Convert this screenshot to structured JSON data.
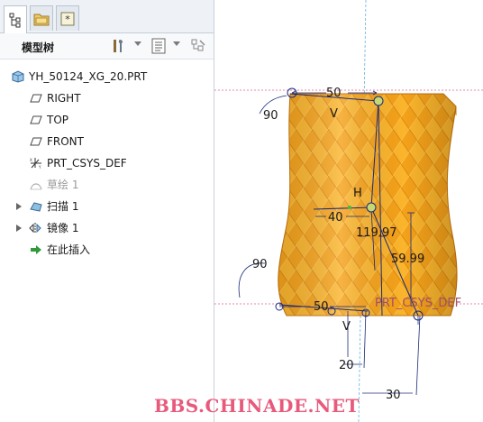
{
  "panel": {
    "tabs": [
      {
        "name": "model-tree-tab"
      },
      {
        "name": "folder-browser-tab"
      },
      {
        "name": "favorites-tab"
      }
    ],
    "title": "模型树",
    "tree": [
      {
        "label": "YH_50124_XG_20.PRT",
        "icon": "part-icon"
      },
      {
        "label": "RIGHT",
        "icon": "datum-plane-icon"
      },
      {
        "label": "TOP",
        "icon": "datum-plane-icon"
      },
      {
        "label": "FRONT",
        "icon": "datum-plane-icon"
      },
      {
        "label": "PRT_CSYS_DEF",
        "icon": "csys-icon"
      },
      {
        "label": "草绘 1",
        "icon": "sketch-icon"
      },
      {
        "label": "扫描 1",
        "icon": "sweep-icon"
      },
      {
        "label": "镜像 1",
        "icon": "mirror-icon"
      },
      {
        "label": "在此插入",
        "icon": "insert-here-icon"
      }
    ]
  },
  "viewport": {
    "dimensions": {
      "top_width": "50",
      "top_angle": "90",
      "label_v_top": "V",
      "label_h": "H",
      "mid_width": "40",
      "mid_height": "119.97",
      "lower_height": "59.99",
      "bottom_angle": "90",
      "bottom_width": "50",
      "label_v_bottom": "V",
      "dim_20": "20",
      "dim_30": "30"
    },
    "csys_label": "PRT_CSYS_DEF",
    "watermark": "BBS.CHINADE.NET",
    "colors": {
      "part": "#f5a21a",
      "datum": "#e0608c",
      "dimension": "#1a2a7a"
    }
  }
}
